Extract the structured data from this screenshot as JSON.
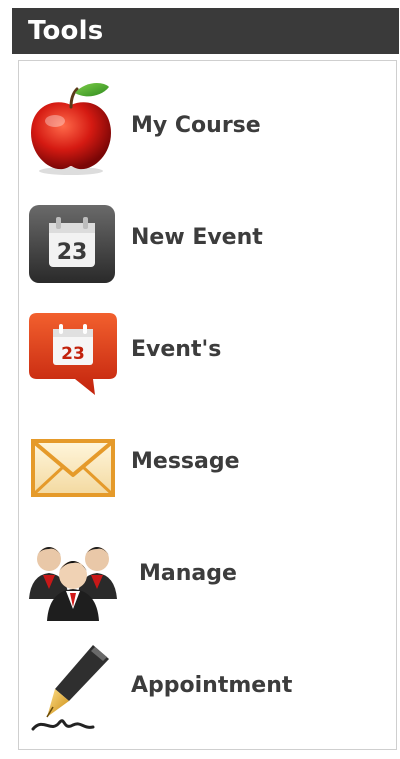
{
  "panel": {
    "title": "Tools"
  },
  "tools": [
    {
      "label": "My Course",
      "icon": "apple-icon"
    },
    {
      "label": "New Event",
      "icon": "calendar-icon"
    },
    {
      "label": "Event's",
      "icon": "calendar-bubble-icon"
    },
    {
      "label": "Message",
      "icon": "envelope-icon"
    },
    {
      "label": "Manage",
      "icon": "users-group-icon"
    },
    {
      "label": "Appointment",
      "icon": "pen-signature-icon"
    }
  ],
  "calendar_day": "23",
  "colors": {
    "header_bg": "#3a3a3a",
    "header_text": "#ffffff",
    "label_text": "#3c3c3c",
    "border": "#cfcfcf"
  }
}
